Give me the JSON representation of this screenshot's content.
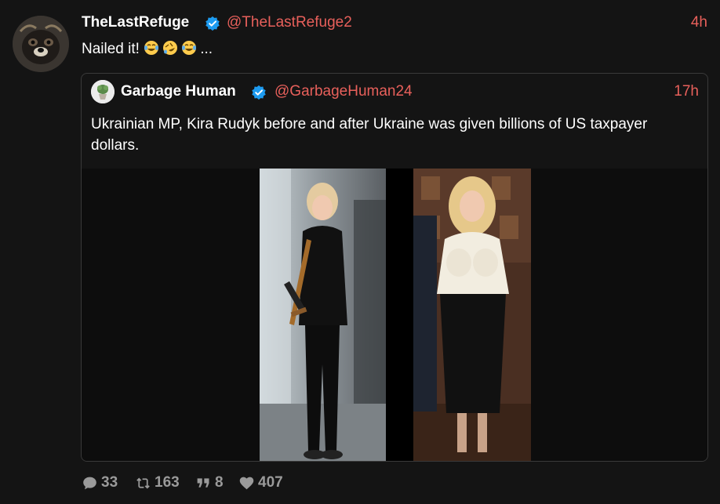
{
  "post": {
    "display_name": "TheLastRefuge",
    "handle": "@TheLastRefuge2",
    "time": "4h",
    "text": "Nailed it!",
    "text_suffix": "...",
    "emojis": [
      "tears-of-joy",
      "rolling-on-floor-laughing",
      "tears-of-joy"
    ]
  },
  "quoted": {
    "display_name": "Garbage Human",
    "handle": "@GarbageHuman24",
    "time": "17h",
    "text": "Ukrainian MP, Kira Rudyk before and after Ukraine was given billions of US taxpayer dollars."
  },
  "stats": {
    "replies": "33",
    "reposts": "163",
    "quotes": "8",
    "likes": "407"
  },
  "colors": {
    "background": "#141414",
    "accent": "#e8605b",
    "verified": "#1d9bf0",
    "muted": "#9a9a9a"
  },
  "icons": {
    "verified": "verified-badge-icon",
    "reply": "reply-bubble-icon",
    "repost": "repost-icon",
    "quote": "quote-icon",
    "like": "heart-icon"
  }
}
